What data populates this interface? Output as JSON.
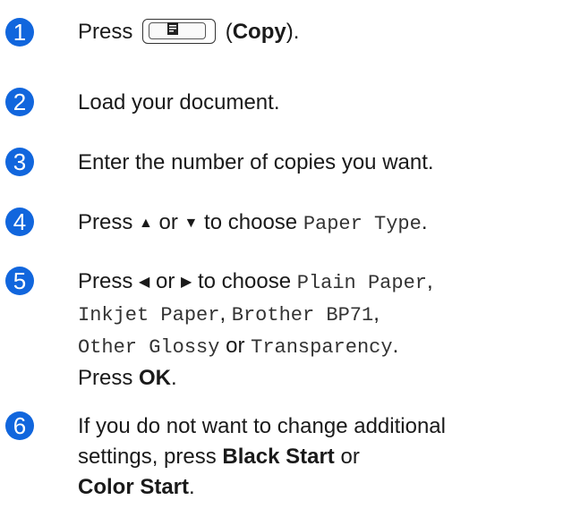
{
  "steps": [
    {
      "num": "1",
      "press": "Press",
      "paren_open": " (",
      "key_label": "Copy",
      "paren_close": ")."
    },
    {
      "num": "2",
      "text": "Load your document."
    },
    {
      "num": "3",
      "text": "Enter the number of copies you want."
    },
    {
      "num": "4",
      "press": "Press ",
      "up": "▲",
      "or": " or ",
      "down": "▼",
      "to_choose": " to choose ",
      "menu_item": "Paper Type",
      "end": "."
    },
    {
      "num": "5",
      "press": "Press ",
      "left": "◀",
      "or": " or ",
      "right": "▶",
      "to_choose": " to choose ",
      "opt1": "Plain Paper",
      "comma1": ",",
      "opt2": "Inkjet Paper",
      "comma2": ", ",
      "opt3": "Brother BP71",
      "comma3": ",",
      "opt4": "Other Glossy",
      "or2": " or ",
      "opt5": "Transparency",
      "end": ".",
      "press2": "Press ",
      "ok": "OK",
      "end2": "."
    },
    {
      "num": "6",
      "line1": "If you do not want to change additional",
      "line2_a": "settings, press ",
      "black_start": "Black Start",
      "line2_b": " or",
      "color_start": "Color Start",
      "end": "."
    }
  ],
  "colors": {
    "accent": "#1166dd"
  },
  "icons": {
    "copy_key": "copy-key-icon"
  }
}
